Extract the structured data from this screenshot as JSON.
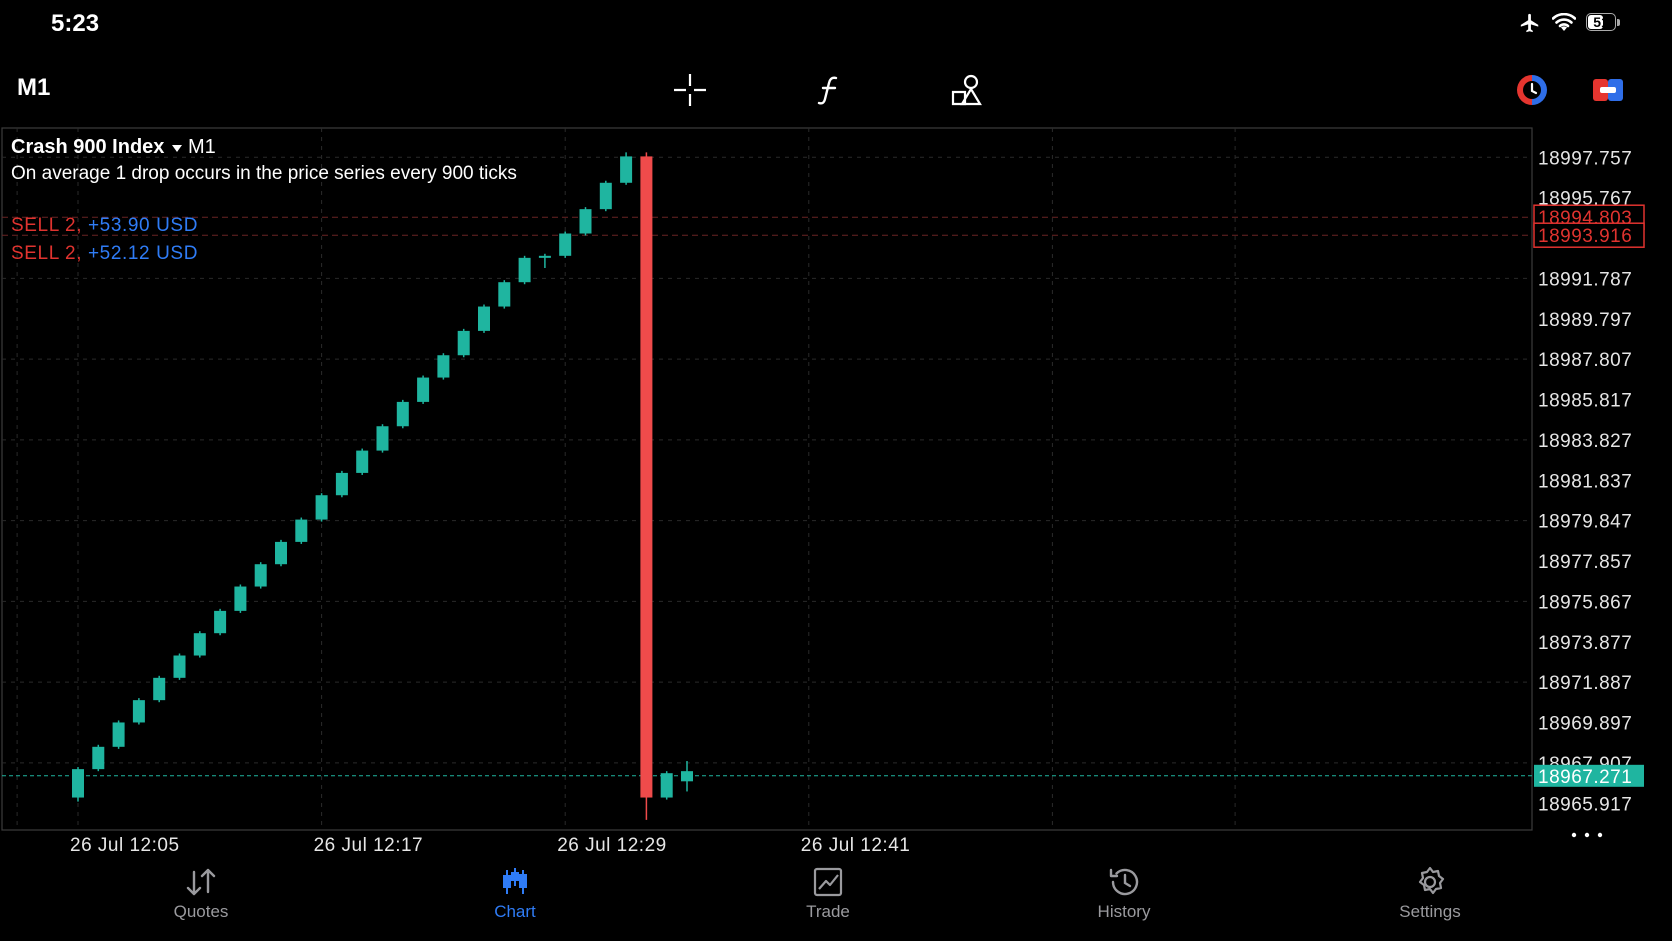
{
  "status_bar": {
    "time": "5:23",
    "battery": "51"
  },
  "toolbar": {
    "timeframe": "M1"
  },
  "chart_data": {
    "type": "candlestick",
    "symbol": "Crash 900 Index",
    "timeframe": "M1",
    "description": "On average 1 drop occurs in the price series every 900 ticks",
    "ylim": [
      18964.6,
      18999.2
    ],
    "y_ticks": [
      "18997.757",
      "18995.767",
      "18991.787",
      "18989.797",
      "18987.807",
      "18985.817",
      "18983.827",
      "18981.837",
      "18979.847",
      "18977.857",
      "18975.867",
      "18973.877",
      "18971.887",
      "18969.897",
      "18967.907",
      "18965.917"
    ],
    "x_ticks": [
      {
        "label": "26 Jul 12:05",
        "minute": 0
      },
      {
        "label": "26 Jul 12:17",
        "minute": 12
      },
      {
        "label": "26 Jul 12:29",
        "minute": 24
      },
      {
        "label": "26 Jul 12:41",
        "minute": 36
      }
    ],
    "price_levels": [
      {
        "label": "SELL 2,",
        "profit": "+53.90 USD",
        "price": 18994.803,
        "price_label": "18994.803",
        "color": "#e0332f"
      },
      {
        "label": "SELL 2,",
        "profit": "+52.12 USD",
        "price": 18993.916,
        "price_label": "18993.916",
        "color": "#e0332f"
      }
    ],
    "current_price": {
      "value": 18967.271,
      "label": "18967.271",
      "color": "#1fb5a0"
    },
    "candles": [
      {
        "o": 18966.2,
        "h": 18967.7,
        "c": 18967.6,
        "l": 18966.0
      },
      {
        "o": 18967.6,
        "h": 18968.8,
        "c": 18968.7,
        "l": 18967.5
      },
      {
        "o": 18968.7,
        "h": 18970.0,
        "c": 18969.9,
        "l": 18968.6
      },
      {
        "o": 18969.9,
        "h": 18971.1,
        "c": 18971.0,
        "l": 18969.8
      },
      {
        "o": 18971.0,
        "h": 18972.2,
        "c": 18972.1,
        "l": 18970.9
      },
      {
        "o": 18972.1,
        "h": 18973.3,
        "c": 18973.2,
        "l": 18972.0
      },
      {
        "o": 18973.2,
        "h": 18974.4,
        "c": 18974.3,
        "l": 18973.1
      },
      {
        "o": 18974.3,
        "h": 18975.5,
        "c": 18975.4,
        "l": 18974.2
      },
      {
        "o": 18975.4,
        "h": 18976.7,
        "c": 18976.6,
        "l": 18975.3
      },
      {
        "o": 18976.6,
        "h": 18977.8,
        "c": 18977.7,
        "l": 18976.5
      },
      {
        "o": 18977.7,
        "h": 18978.9,
        "c": 18978.8,
        "l": 18977.6
      },
      {
        "o": 18978.8,
        "h": 18980.0,
        "c": 18979.9,
        "l": 18978.7
      },
      {
        "o": 18979.9,
        "h": 18981.2,
        "c": 18981.1,
        "l": 18979.8
      },
      {
        "o": 18981.1,
        "h": 18982.3,
        "c": 18982.2,
        "l": 18981.0
      },
      {
        "o": 18982.2,
        "h": 18983.4,
        "c": 18983.3,
        "l": 18982.1
      },
      {
        "o": 18983.3,
        "h": 18984.6,
        "c": 18984.5,
        "l": 18983.2
      },
      {
        "o": 18984.5,
        "h": 18985.8,
        "c": 18985.7,
        "l": 18984.4
      },
      {
        "o": 18985.7,
        "h": 18987.0,
        "c": 18986.9,
        "l": 18985.6
      },
      {
        "o": 18986.9,
        "h": 18988.1,
        "c": 18988.0,
        "l": 18986.8
      },
      {
        "o": 18988.0,
        "h": 18989.3,
        "c": 18989.2,
        "l": 18987.9
      },
      {
        "o": 18989.2,
        "h": 18990.5,
        "c": 18990.4,
        "l": 18989.1
      },
      {
        "o": 18990.4,
        "h": 18991.7,
        "c": 18991.6,
        "l": 18990.3
      },
      {
        "o": 18991.6,
        "h": 18992.9,
        "c": 18992.8,
        "l": 18991.5
      },
      {
        "o": 18992.8,
        "h": 18993.0,
        "c": 18992.9,
        "l": 18992.3
      },
      {
        "o": 18992.9,
        "h": 18994.1,
        "c": 18994.0,
        "l": 18992.8
      },
      {
        "o": 18994.0,
        "h": 18995.3,
        "c": 18995.2,
        "l": 18993.9
      },
      {
        "o": 18995.2,
        "h": 18996.6,
        "c": 18996.5,
        "l": 18995.1
      },
      {
        "o": 18996.5,
        "h": 18998.0,
        "c": 18997.8,
        "l": 18996.4
      },
      {
        "o": 18997.8,
        "h": 18998.0,
        "c": 18966.2,
        "l": 18965.1
      },
      {
        "o": 18966.2,
        "h": 18967.5,
        "c": 18967.4,
        "l": 18966.1
      },
      {
        "o": 18967.0,
        "h": 18968.0,
        "c": 18967.5,
        "l": 18966.5
      }
    ]
  },
  "nav": {
    "items": [
      {
        "label": "Quotes"
      },
      {
        "label": "Chart"
      },
      {
        "label": "Trade"
      },
      {
        "label": "History"
      },
      {
        "label": "Settings"
      }
    ]
  }
}
